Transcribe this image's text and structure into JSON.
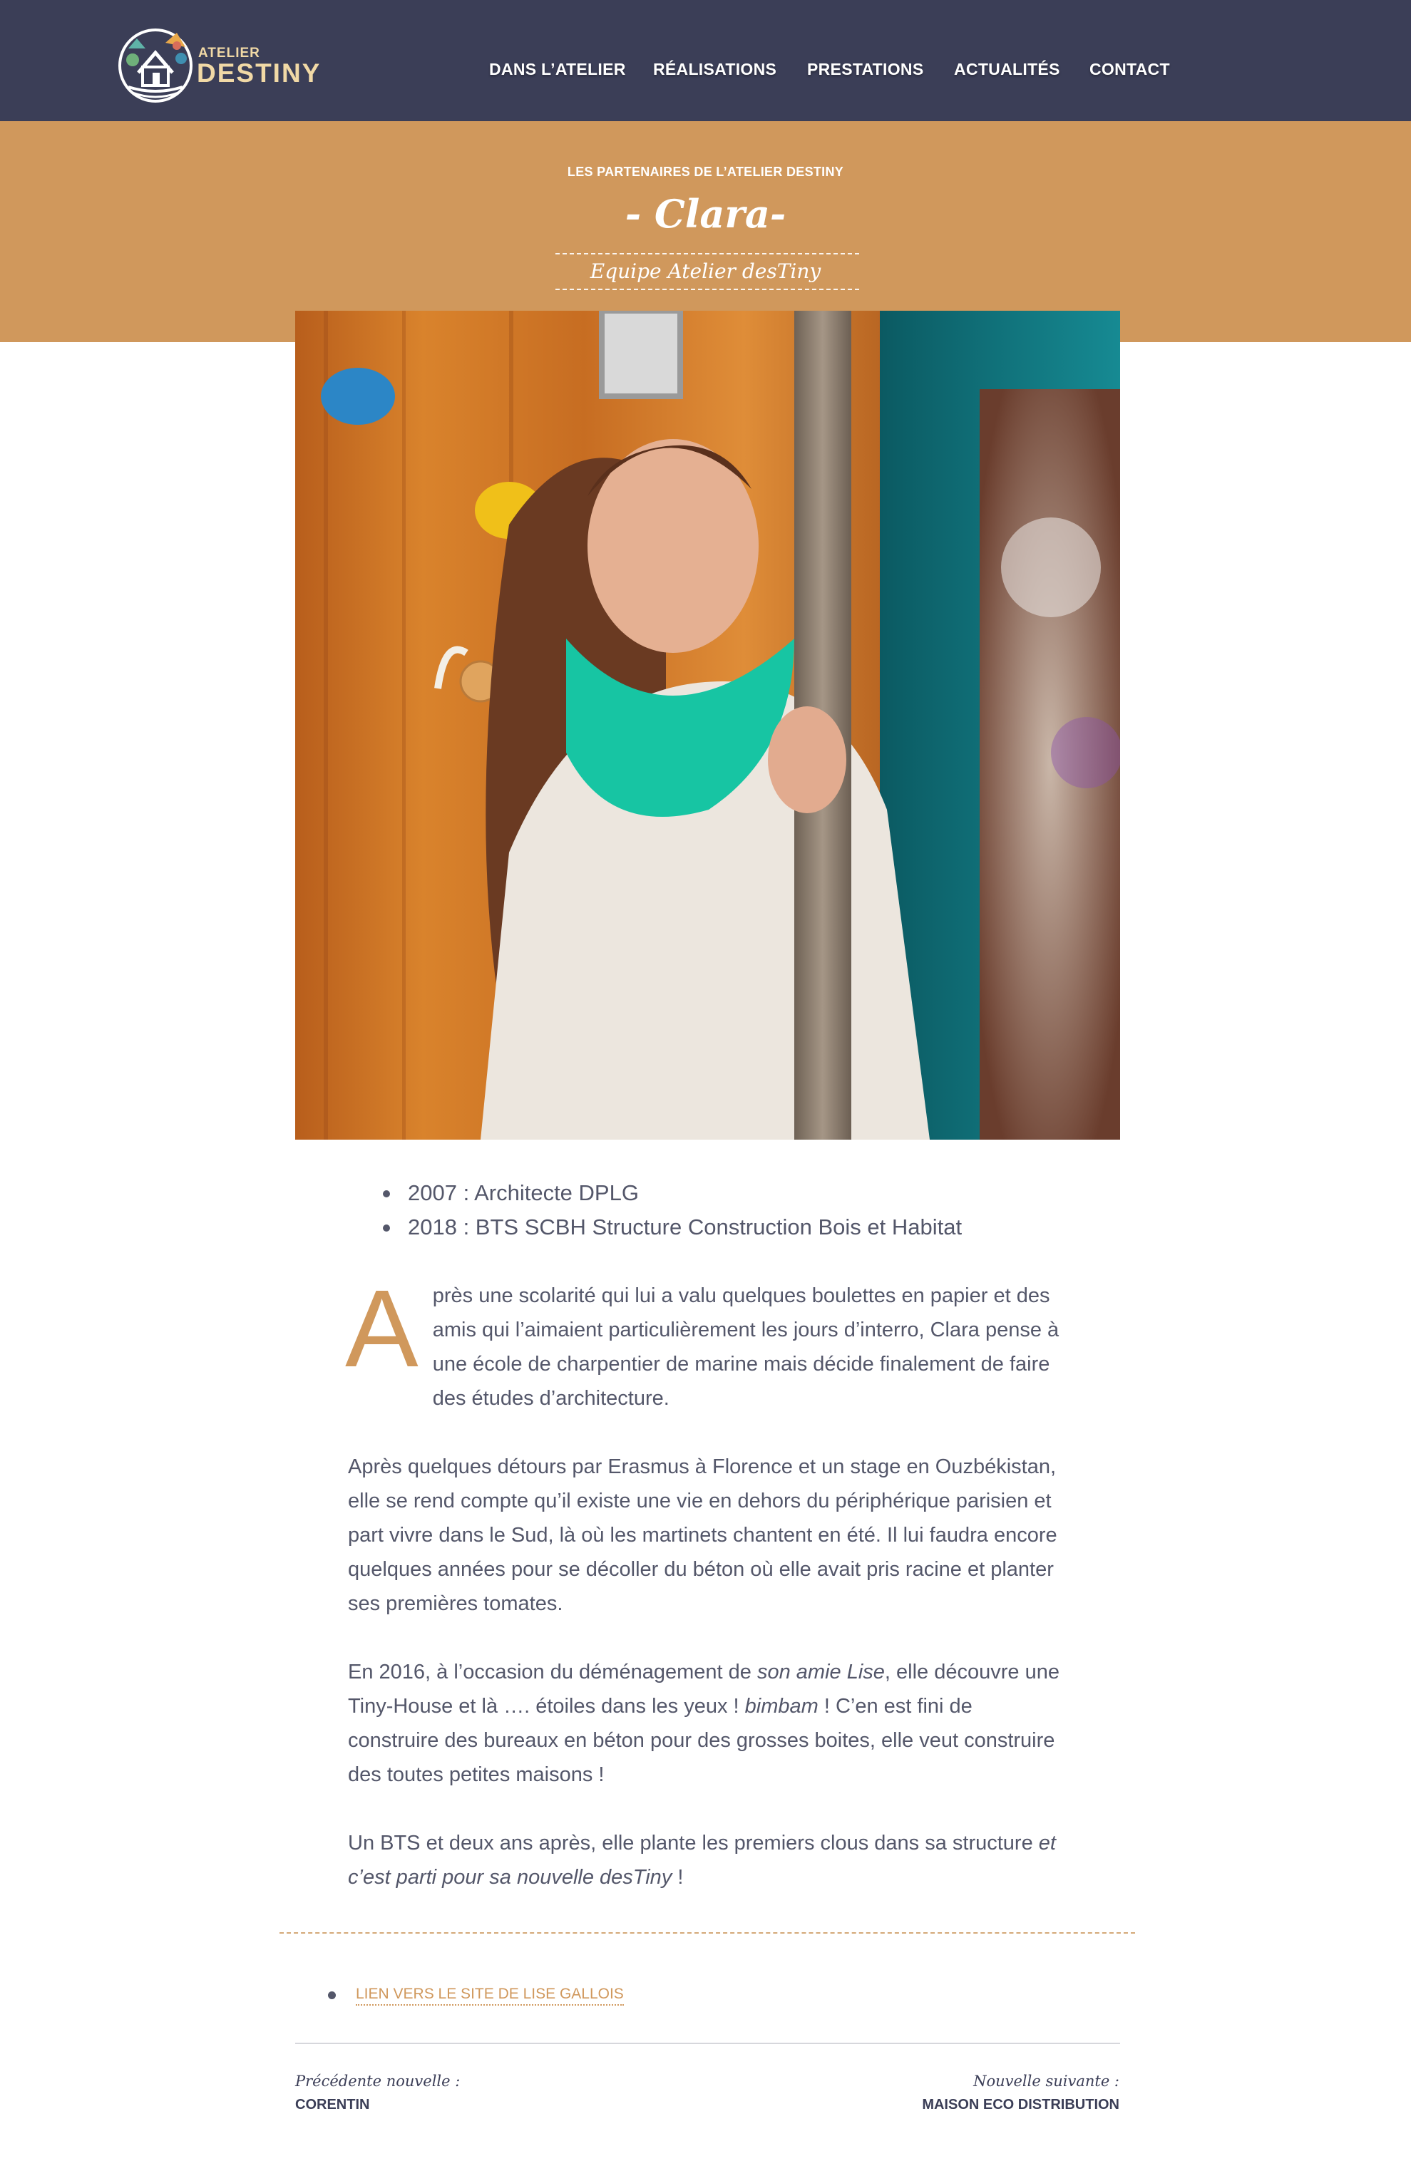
{
  "logo": {
    "line1": "ATELIER",
    "line2": "DESTINY"
  },
  "nav": {
    "items": [
      {
        "label": "DANS L’ATELIER"
      },
      {
        "label": "RÉALISATIONS"
      },
      {
        "label": "PRESTATIONS"
      },
      {
        "label": "ACTUALITÉS"
      },
      {
        "label": "CONTACT"
      }
    ]
  },
  "hero": {
    "eyebrow": "LES PARTENAIRES DE L’ATELIER DESTINY",
    "title": "- Clara-",
    "subtitle": "Equipe Atelier desTiny"
  },
  "qualifications": [
    "2007 : Architecte DPLG",
    "2018 : BTS SCBH Structure Construction Bois et Habitat"
  ],
  "article": {
    "p1_dropcap": "A",
    "p1_text": "près une scolarité qui lui a valu quelques boulettes en papier et des amis qui l’aimaient particulièrement les jours d’interro, Clara pense à une école de charpentier de marine mais décide finalement de faire des études d’architecture.",
    "p2": "Après quelques détours par Erasmus à Florence et un stage en Ouzbékistan, elle se rend compte qu’il existe une vie en dehors du périphérique parisien et part vivre dans le Sud, là où les martinets chantent en été. Il lui faudra encore quelques années pour se décoller du béton où elle avait pris racine et planter ses premières tomates.",
    "p3_a": "En 2016, à l’occasion du déménagement de ",
    "p3_b": "son amie Lise",
    "p3_c": ", elle découvre une Tiny-House et là …. étoiles dans les yeux ! ",
    "p3_d": "bimbam",
    "p3_e": " ! C’en est fini de construire des bureaux en béton pour des grosses boites, elle veut construire des toutes petites maisons !",
    "p4_a": "Un BTS et deux ans après, elle plante les premiers clous dans sa structure ",
    "p4_b": "et c’est parti pour sa nouvelle desTiny",
    "p4_c": " !"
  },
  "links": [
    {
      "label": "LIEN VERS LE SITE DE LISE GALLOIS"
    }
  ],
  "pagination": {
    "prev_label": "Précédente nouvelle :",
    "prev_title": "CORENTIN",
    "next_label": "Nouvelle suivante :",
    "next_title": "MAISON ECO DISTRIBUTION"
  },
  "colors": {
    "header_bg": "#3b3e57",
    "accent": "#d0985c",
    "text": "#54576a"
  }
}
